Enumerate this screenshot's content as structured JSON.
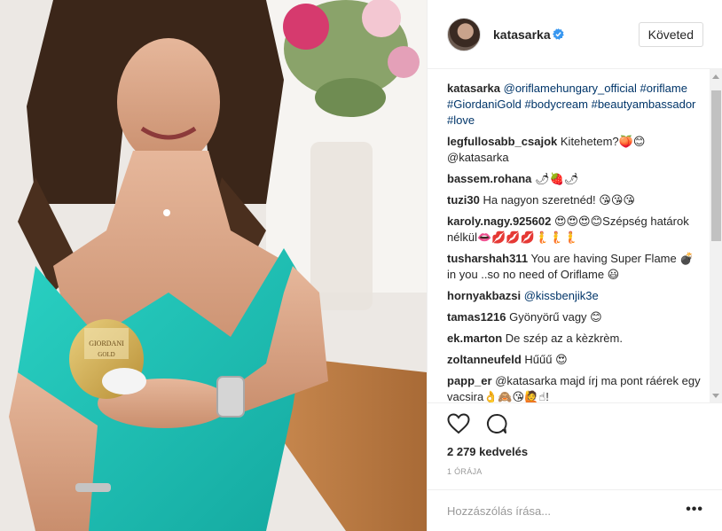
{
  "post": {
    "username": "katasarka",
    "verified_icon": "verified-badge-icon",
    "follow_label": "Követed",
    "likes_text": "2 279 kedvelés",
    "time_text": "1 ÓRÁJA",
    "comment_placeholder": "Hozzászólás írása...",
    "more_label": "•••",
    "accent_color": "#003569",
    "verified_color": "#3897f0"
  },
  "caption": {
    "author": "katasarka",
    "text": "@oriflamehungary_official #oriflame #GiordaniGold #bodycream #beautyambassador #love"
  },
  "comments": [
    {
      "author": "legfullosabb_csajok",
      "text": "Kitehetem?🍑😊 @katasarka"
    },
    {
      "author": "bassem.rohana",
      "text": "🌶🍓🌶"
    },
    {
      "author": "tuzi30",
      "text": "Ha nagyon szeretnéd! 😘😘😘"
    },
    {
      "author": "karoly.nagy.925602",
      "text": "😍😍😍😊Szépség határok nélkül👄💋💋💋🧜🧜🧜"
    },
    {
      "author": "tusharshah311",
      "text": "You are having Super Flame 💣 in you ..so no need of Oriflame 😃"
    },
    {
      "author": "hornyakbazsi",
      "text": "@kissbenjik3e"
    },
    {
      "author": "tamas1216",
      "text": "Gyönyörű vagy 😊"
    },
    {
      "author": "ek.marton",
      "text": "De szép az a kèzkrèm."
    },
    {
      "author": "zoltanneufeld",
      "text": "Hűűű 😍"
    },
    {
      "author": "papp_er",
      "text": "@katasarka majd írj ma pont ráérek egy vacsira👌🙈😘🙋☝!"
    }
  ],
  "product": {
    "brand": "GIORDANI",
    "line": "GOLD"
  },
  "icons": {
    "like": "heart-outline-icon",
    "comment": "comment-bubble-icon"
  }
}
